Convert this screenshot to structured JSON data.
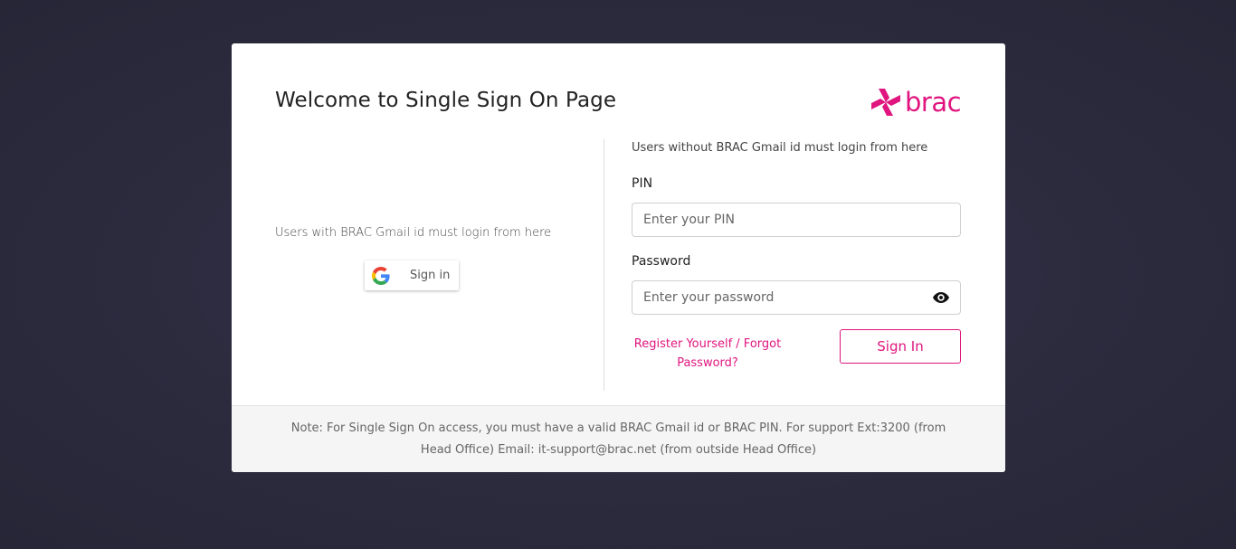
{
  "header": {
    "title": "Welcome to Single Sign On Page",
    "logo_text": "brac"
  },
  "left_panel": {
    "info_text": "Users with BRAC Gmail id must login from here",
    "google_button": {
      "label": "Sign in",
      "icon": "google-g-icon"
    }
  },
  "right_panel": {
    "info_text": "Users without BRAC Gmail id must login from here",
    "pin": {
      "label": "PIN",
      "placeholder": "Enter your PIN",
      "value": ""
    },
    "password": {
      "label": "Password",
      "placeholder": "Enter your password",
      "value": "",
      "toggle_icon": "eye-icon"
    },
    "register_link": "Register Yourself / Forgot Password?",
    "signin_button": "Sign In"
  },
  "footer": {
    "note": "Note: For Single Sign On access, you must have a valid BRAC Gmail id or BRAC PIN. For support Ext:3200 (from Head Office) Email: it-support@brac.net (from outside Head Office)"
  },
  "colors": {
    "accent": "#e0157f",
    "background": "#2c2b3e",
    "card": "#ffffff",
    "footer": "#f5f5f5"
  }
}
